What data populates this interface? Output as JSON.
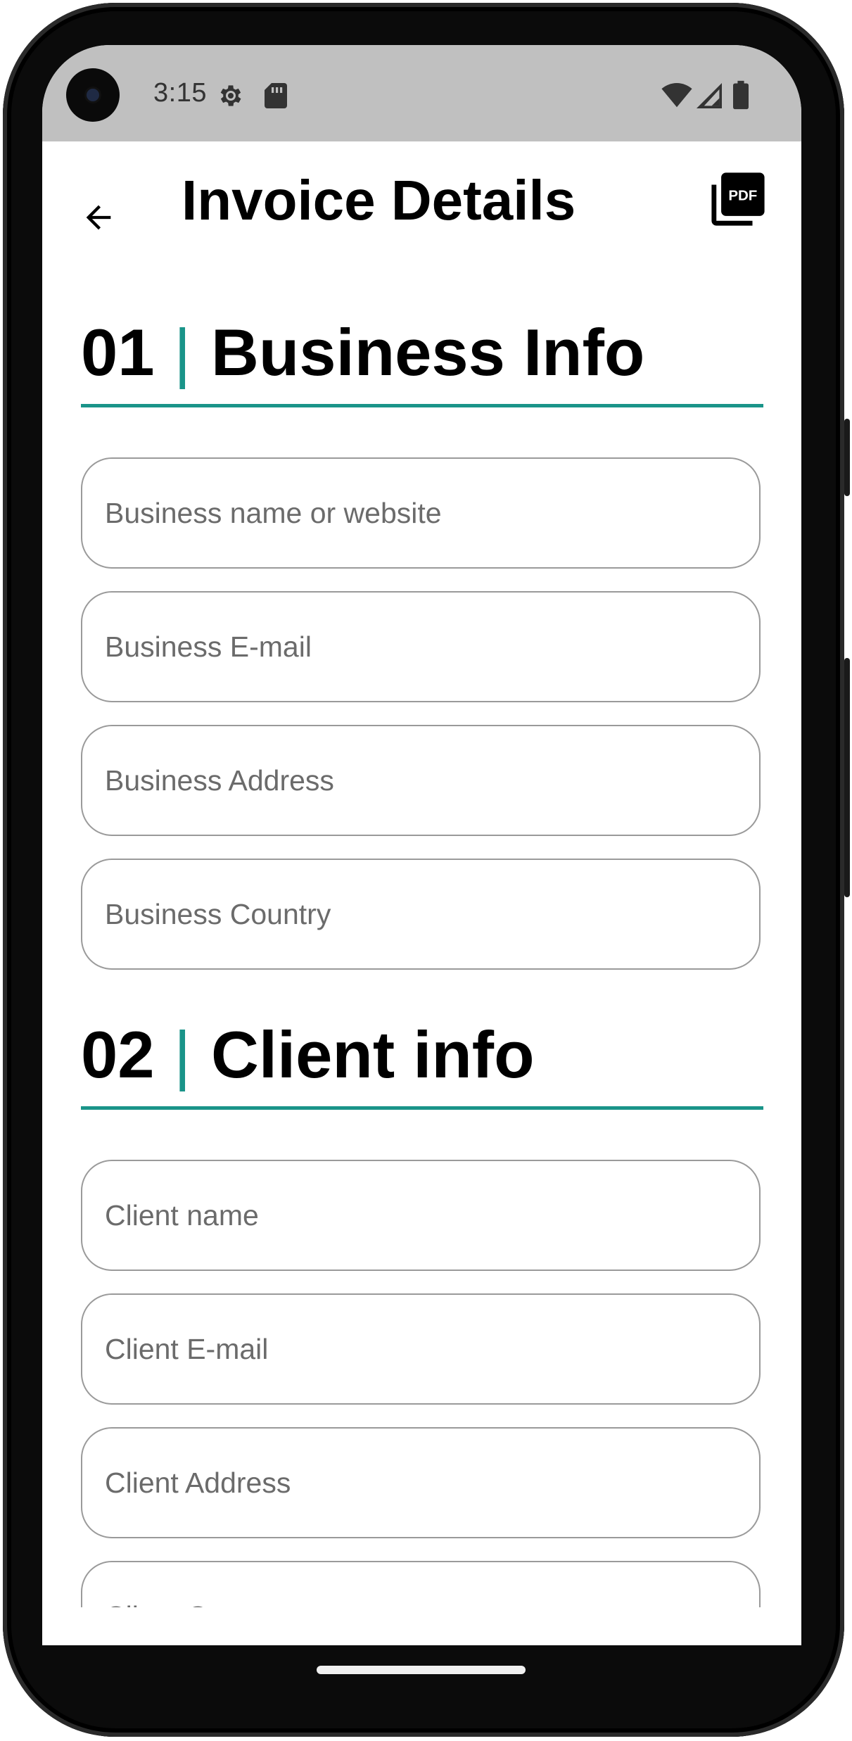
{
  "status_bar": {
    "time": "3:15",
    "icons": [
      "settings-gear-icon",
      "sd-card-icon",
      "wifi-icon",
      "cell-signal-icon",
      "battery-icon"
    ]
  },
  "app_bar": {
    "title": "Invoice Details",
    "back_icon": "arrow-back-icon",
    "action_icon": "pdf-icon",
    "action_label": "PDF"
  },
  "sections": [
    {
      "number": "01",
      "separator": "|",
      "title": "Business Info",
      "fields": [
        {
          "placeholder": "Business name or website",
          "value": ""
        },
        {
          "placeholder": "Business E-mail",
          "value": ""
        },
        {
          "placeholder": "Business Address",
          "value": ""
        },
        {
          "placeholder": "Business Country",
          "value": ""
        }
      ]
    },
    {
      "number": "02",
      "separator": "|",
      "title": "Client info",
      "fields": [
        {
          "placeholder": "Client name",
          "value": ""
        },
        {
          "placeholder": "Client E-mail",
          "value": ""
        },
        {
          "placeholder": "Client Address",
          "value": ""
        },
        {
          "placeholder": "Client Country",
          "value": ""
        }
      ]
    }
  ],
  "colors": {
    "accent": "#1a9489",
    "status_bar_bg": "#c0c0c0",
    "field_border": "#9a9a9a",
    "placeholder": "#6b6b6b"
  }
}
